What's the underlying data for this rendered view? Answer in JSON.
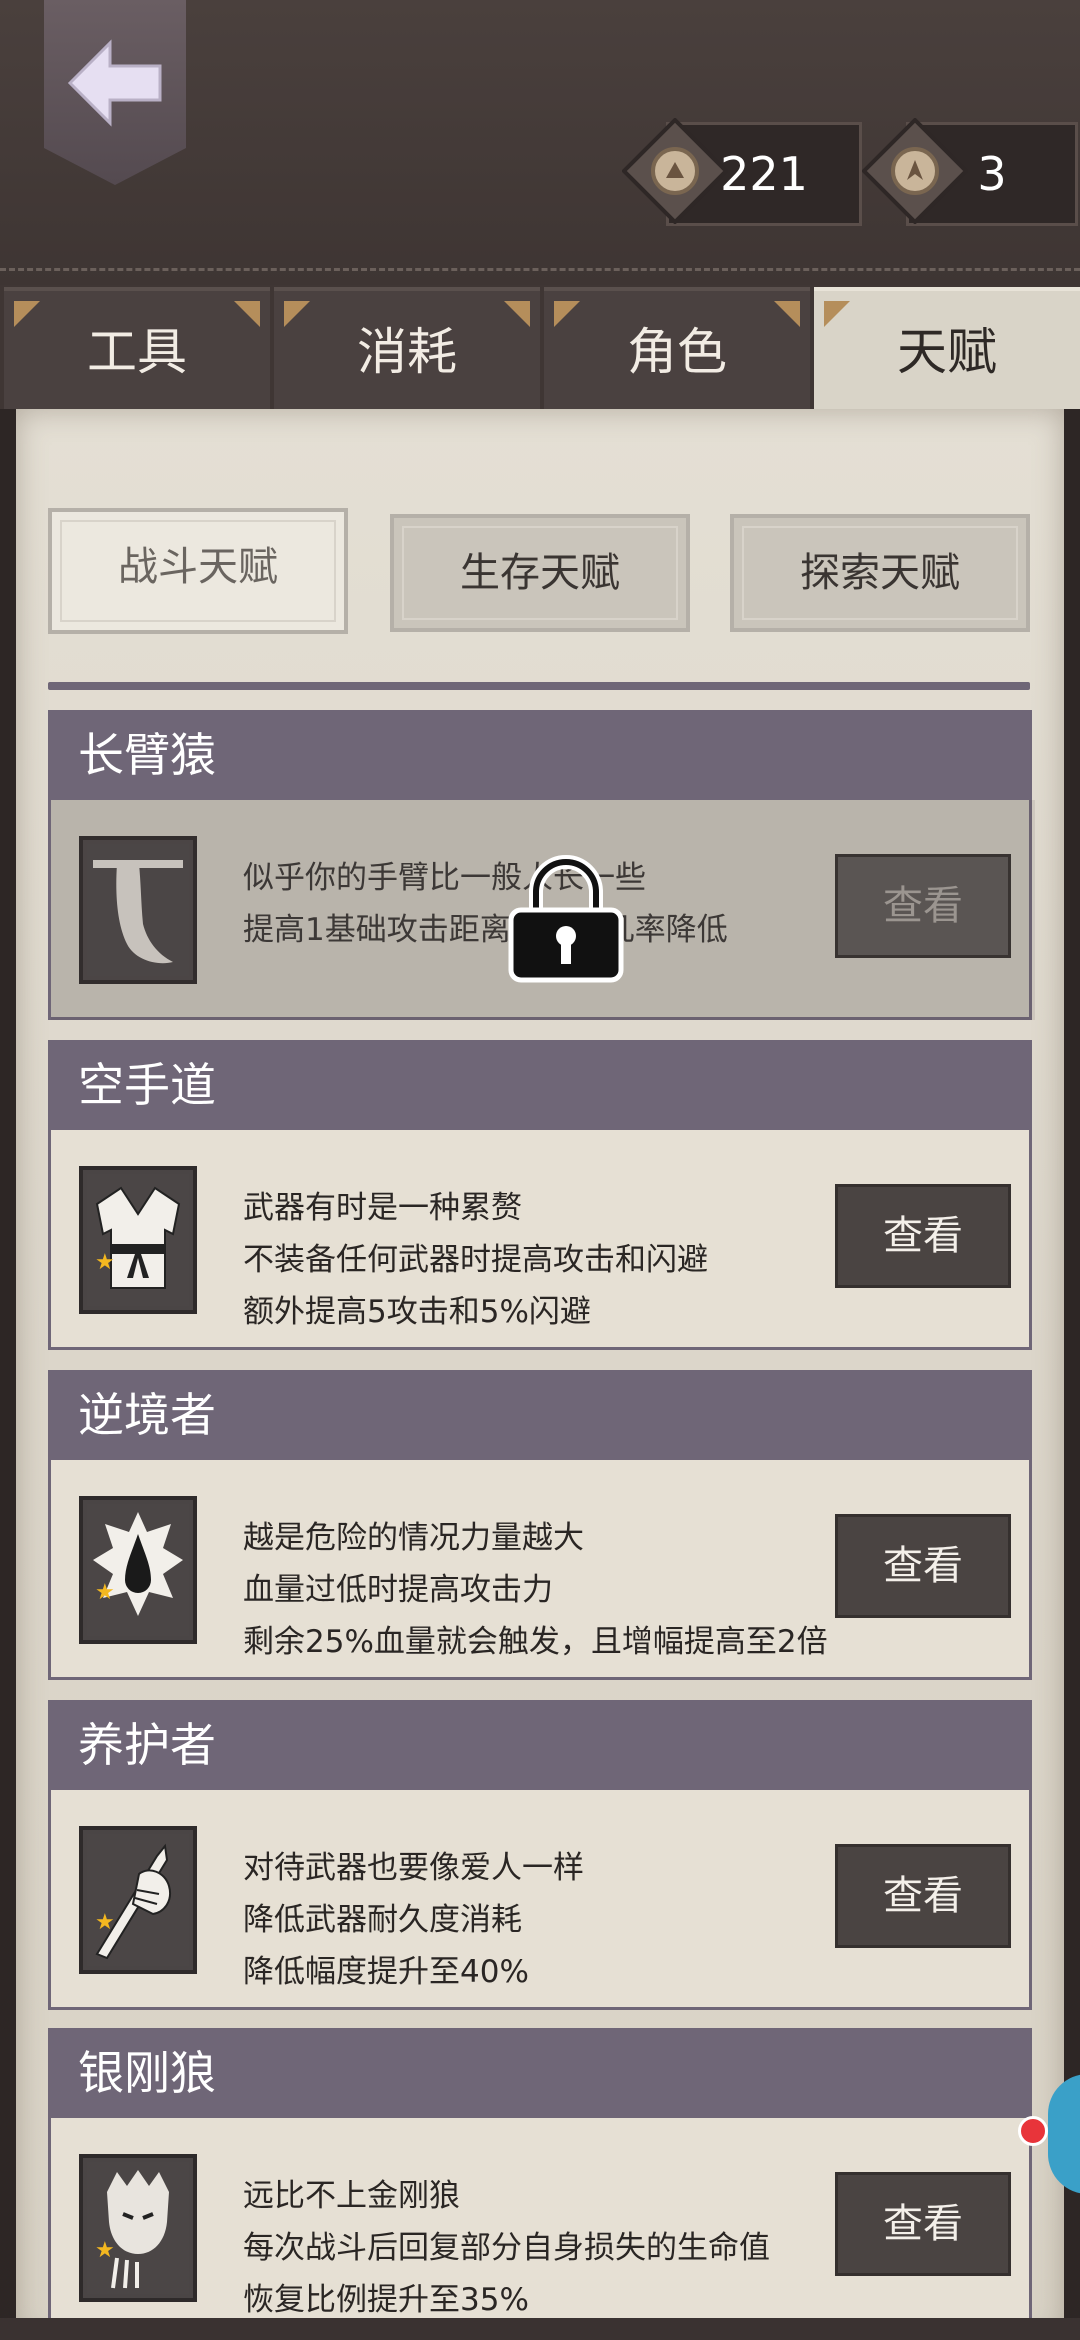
{
  "currencies": [
    {
      "icon": "coin-icon",
      "value": "221"
    },
    {
      "icon": "token-icon",
      "value": "3"
    }
  ],
  "main_tabs": [
    {
      "label": "工具",
      "active": false
    },
    {
      "label": "消耗",
      "active": false
    },
    {
      "label": "角色",
      "active": false
    },
    {
      "label": "天赋",
      "active": true
    }
  ],
  "sub_tabs": [
    {
      "label": "战斗天赋",
      "active": true
    },
    {
      "label": "生存天赋",
      "active": false
    },
    {
      "label": "探索天赋",
      "active": false
    }
  ],
  "talents": [
    {
      "name": "长臂猿",
      "icon": "long-arm-icon",
      "locked": true,
      "lines": [
        "似乎你的手臂比一般人长一些",
        "提高1基础攻击距离，闪避几率降低"
      ],
      "view_label": "查看"
    },
    {
      "name": "空手道",
      "icon": "karate-gi-icon",
      "locked": false,
      "stars": 1,
      "lines": [
        "武器有时是一种累赘",
        "不装备任何武器时提高攻击和闪避",
        "额外提高5攻击和5%闪避"
      ],
      "view_label": "查看"
    },
    {
      "name": "逆境者",
      "icon": "blood-drop-icon",
      "locked": false,
      "stars": 1,
      "lines": [
        "越是危险的情况力量越大",
        "血量过低时提高攻击力",
        "剩余25%血量就会触发，且增幅提高至2倍"
      ],
      "view_label": "查看"
    },
    {
      "name": "养护者",
      "icon": "weapon-care-icon",
      "locked": false,
      "stars": 1,
      "lines": [
        "对待武器也要像爱人一样",
        "降低武器耐久度消耗",
        "降低幅度提升至40%"
      ],
      "view_label": "查看"
    },
    {
      "name": "银刚狼",
      "icon": "wolverine-icon",
      "locked": false,
      "stars": 1,
      "lines": [
        "远比不上金刚狼",
        "每次战斗后回复部分自身损失的生命值",
        "恢复比例提升至35%"
      ],
      "view_label": "查看"
    }
  ],
  "colors": {
    "accent_purple": "#6f6677",
    "parchment": "#e4dfd4",
    "leather": "#3f3634",
    "star": "#f4b820"
  }
}
